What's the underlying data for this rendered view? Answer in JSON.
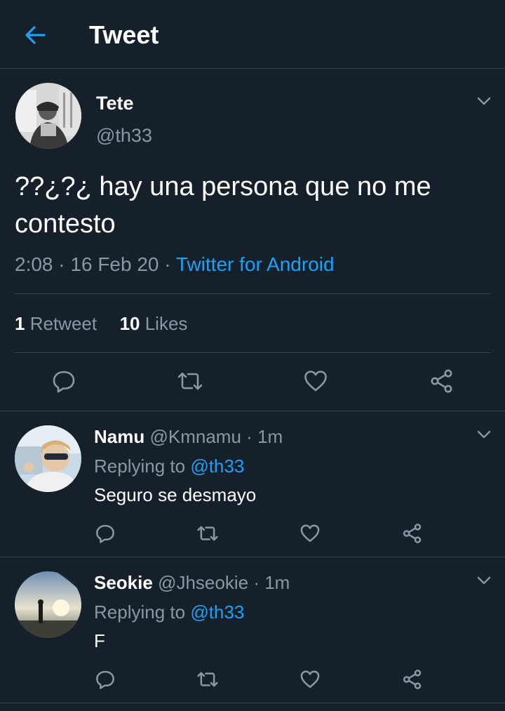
{
  "header": {
    "title": "Tweet",
    "back_icon": "arrow-left-icon"
  },
  "colors": {
    "background": "#15202b",
    "accent": "#1da1f2",
    "muted": "#8899a6",
    "divider": "#38444d"
  },
  "tweet": {
    "display_name": "Tete",
    "handle": "@th33",
    "text": "??¿?¿ hay una persona que no me contesto",
    "time": "2:08",
    "sep1": "·",
    "date": "16 Feb 20",
    "sep2": "·",
    "source": "Twitter for Android",
    "retweets_count": "1",
    "retweets_label": "Retweet",
    "likes_count": "10",
    "likes_label": "Likes",
    "actions": [
      "reply-icon",
      "retweet-icon",
      "like-icon",
      "share-icon"
    ]
  },
  "replies": [
    {
      "display_name": "Namu",
      "handle": "@Kmnamu",
      "sep": "·",
      "time": "1m",
      "replying_label": "Replying to",
      "replying_to": "@th33",
      "text": "Seguro se desmayo"
    },
    {
      "display_name": "Seokie",
      "handle": "@Jhseokie",
      "sep": "·",
      "time": "1m",
      "replying_label": "Replying to",
      "replying_to": "@th33",
      "text": "F"
    }
  ]
}
